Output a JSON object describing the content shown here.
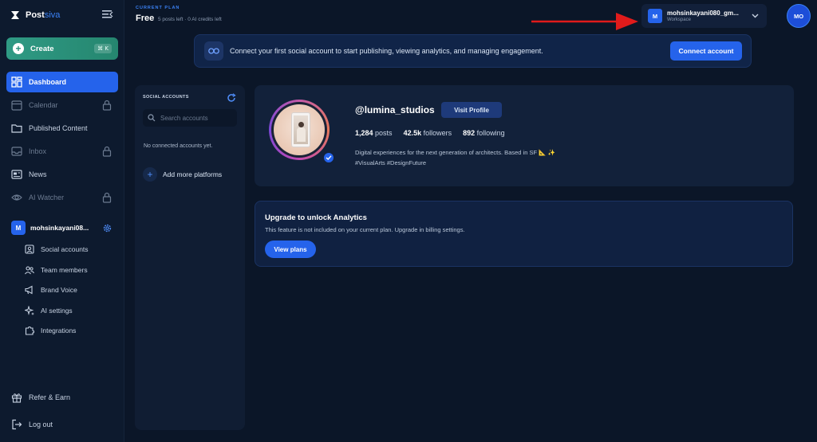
{
  "brand": {
    "name_main": "Post",
    "name_accent": "siva"
  },
  "sidebar": {
    "create_label": "Create",
    "create_shortcut": "⌘ K",
    "items": [
      {
        "label": "Dashboard",
        "icon": "dashboard-icon",
        "active": true,
        "locked": false
      },
      {
        "label": "Calendar",
        "icon": "calendar-icon",
        "active": false,
        "locked": true
      },
      {
        "label": "Published Content",
        "icon": "folder-icon",
        "active": false,
        "locked": false
      },
      {
        "label": "Inbox",
        "icon": "inbox-icon",
        "active": false,
        "locked": true
      },
      {
        "label": "News",
        "icon": "news-icon",
        "active": false,
        "locked": false
      },
      {
        "label": "AI Watcher",
        "icon": "eye-icon",
        "active": false,
        "locked": true
      }
    ],
    "workspace": {
      "avatar": "M",
      "name": "mohsinkayani08..."
    },
    "sub_items": [
      {
        "label": "Social accounts",
        "icon": "social-accounts-icon"
      },
      {
        "label": "Team members",
        "icon": "team-icon"
      },
      {
        "label": "Brand Voice",
        "icon": "megaphone-icon"
      },
      {
        "label": "AI settings",
        "icon": "sparkles-icon"
      },
      {
        "label": "Integrations",
        "icon": "puzzle-icon"
      }
    ],
    "footer": [
      {
        "label": "Refer & Earn",
        "icon": "gift-icon"
      },
      {
        "label": "Log out",
        "icon": "logout-icon"
      }
    ]
  },
  "topbar": {
    "plan_label": "CURRENT PLAN",
    "plan_name": "Free",
    "plan_detail": "5 posts left · 0 AI credits left",
    "workspace_avatar": "M",
    "workspace_name": "mohsinkayani080_gm...",
    "workspace_sub": "Workspace",
    "user_initials": "MO"
  },
  "banner": {
    "text": "Connect your first social account to start publishing, viewing analytics, and managing engagement.",
    "button": "Connect account"
  },
  "social_panel": {
    "title": "SOCIAL ACCOUNTS",
    "search_placeholder": "Search accounts",
    "empty": "No connected accounts yet.",
    "add_label": "Add more platforms"
  },
  "profile": {
    "handle": "@lumina_studios",
    "visit_label": "Visit Profile",
    "posts_value": "1,284",
    "posts_label": "posts",
    "followers_value": "42.5k",
    "followers_label": "followers",
    "following_value": "892",
    "following_label": "following",
    "bio_line1": "Digital experiences for the next generation of architects. Based in SF 📐 ✨",
    "bio_line2": "#VisualArts #DesignFuture"
  },
  "upgrade": {
    "title": "Upgrade to unlock Analytics",
    "desc": "This feature is not included on your current plan. Upgrade in billing settings.",
    "button": "View plans"
  },
  "colors": {
    "accent": "#2563eb",
    "create": "#2a8f7a",
    "background": "#0b1628",
    "arrow": "#e01b1b"
  }
}
